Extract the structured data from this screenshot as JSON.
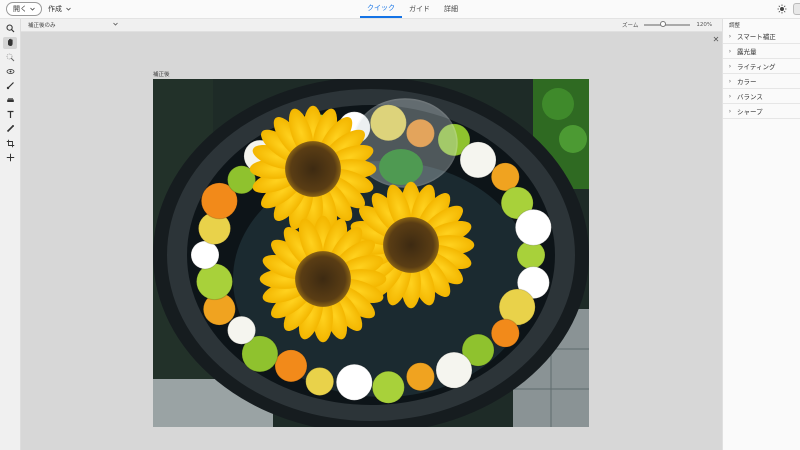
{
  "topbar": {
    "open_label": "開く",
    "create_label": "作成",
    "tabs": [
      {
        "label": "クイック",
        "active": true
      },
      {
        "label": "ガイド",
        "active": false
      },
      {
        "label": "詳細",
        "active": false
      }
    ]
  },
  "subbar": {
    "view_select": "補正後のみ",
    "zoom_label": "ズーム",
    "zoom_value": "120%",
    "zoom_fraction": 0.4
  },
  "canvas": {
    "image_label": "補正後"
  },
  "tools": [
    "search-icon",
    "hand-icon",
    "quick-select-icon",
    "eye-icon",
    "brush-icon",
    "whiten-teeth-icon",
    "text-icon",
    "spot-heal-icon",
    "crop-icon",
    "move-icon"
  ],
  "right_panel": {
    "title": "調整",
    "items": [
      {
        "label": "スマート補正"
      },
      {
        "label": "露光量"
      },
      {
        "label": "ライティング"
      },
      {
        "label": "カラー"
      },
      {
        "label": "バランス"
      },
      {
        "label": "シャープ"
      }
    ]
  },
  "colors": {
    "accent": "#1473e6"
  }
}
